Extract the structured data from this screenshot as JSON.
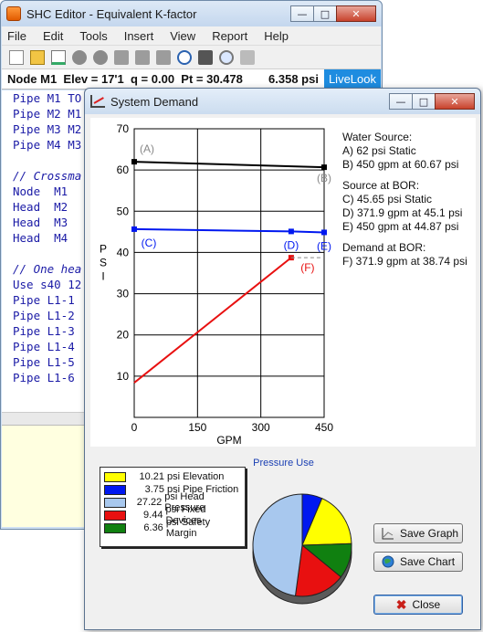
{
  "editor": {
    "title": "SHC Editor - Equivalent K-factor",
    "menu": [
      "File",
      "Edit",
      "Tools",
      "Insert",
      "View",
      "Report",
      "Help"
    ],
    "status": {
      "node": "Node M1",
      "elev": "Elev = 17'1",
      "q": "q = 0.00",
      "pt": "Pt = 30.478",
      "psi": "6.358 psi",
      "livelook": "LiveLook"
    },
    "code_lines": [
      "Pipe M1 TO",
      "Pipe M2 M1",
      "Pipe M3 M2",
      "Pipe M4 M3",
      "",
      "// Crossma",
      "Node  M1",
      "Head  M2",
      "Head  M3",
      "Head  M4",
      "",
      "// One hea",
      "Use s40 12",
      "Pipe L1-1",
      "Pipe L1-2",
      "Pipe L1-3",
      "Pipe L1-4",
      "Pipe L1-5",
      "Pipe L1-6"
    ]
  },
  "dialog": {
    "title": "System Demand",
    "info": {
      "water_source_h": "Water Source:",
      "a": "A) 62 psi Static",
      "b": "B) 450 gpm at 60.67 psi",
      "bor_h": "Source at BOR:",
      "c": "C) 45.65 psi Static",
      "d": "D) 371.9 gpm at 45.1 psi",
      "e": "E) 450 gpm at 44.87 psi",
      "demand_h": "Demand at BOR:",
      "f": "F) 371.9 gpm at 38.74 psi"
    },
    "pressure_use_title": "Pressure Use",
    "legend": [
      {
        "value": "10.21",
        "label": "psi Elevation",
        "color": "#ffff00"
      },
      {
        "value": "3.75",
        "label": "psi Pipe Friction",
        "color": "#0018f0"
      },
      {
        "value": "27.22",
        "label": "psi Head Pressure",
        "color": "#a8c8ee"
      },
      {
        "value": "9.44",
        "label": "psi Fixed Devices",
        "color": "#e81010"
      },
      {
        "value": "6.36",
        "label": "psi Safety Margin",
        "color": "#108010"
      }
    ],
    "buttons": {
      "save_graph": "Save Graph",
      "save_chart": "Save Chart",
      "close": "Close"
    }
  },
  "chart_data": [
    {
      "type": "line",
      "xlabel": "GPM",
      "ylabel": "PSI",
      "xlim": [
        0,
        450
      ],
      "ylim": [
        0,
        70
      ],
      "xticks": [
        0,
        150,
        300,
        450
      ],
      "yticks": [
        10,
        20,
        30,
        40,
        50,
        60,
        70
      ],
      "grid": true,
      "series": [
        {
          "color": "#000000",
          "points": [
            [
              0,
              62
            ],
            [
              450,
              60.67
            ]
          ],
          "labels": [
            "(A)",
            "(B)"
          ]
        },
        {
          "color": "#0018f0",
          "points": [
            [
              0,
              45.65
            ],
            [
              371.9,
              45.1
            ],
            [
              450,
              44.87
            ]
          ],
          "labels": [
            "(C)",
            "(D)",
            "(E)"
          ]
        },
        {
          "color": "#e81010",
          "points": [
            [
              0,
              8.4
            ],
            [
              371.9,
              38.74
            ]
          ],
          "labels": [
            "",
            "(F)"
          ]
        },
        {
          "color": "#888888",
          "dashed": true,
          "points": [
            [
              371.9,
              38.74
            ],
            [
              450,
              38.74
            ]
          ],
          "labels": [
            "",
            ""
          ]
        }
      ]
    },
    {
      "type": "pie",
      "title": "Pressure Use",
      "categories": [
        "Elevation",
        "Pipe Friction",
        "Head Pressure",
        "Fixed Devices",
        "Safety Margin"
      ],
      "values": [
        10.21,
        3.75,
        27.22,
        9.44,
        6.36
      ],
      "colors": [
        "#ffff00",
        "#0018f0",
        "#a8c8ee",
        "#e81010",
        "#108010"
      ]
    }
  ]
}
